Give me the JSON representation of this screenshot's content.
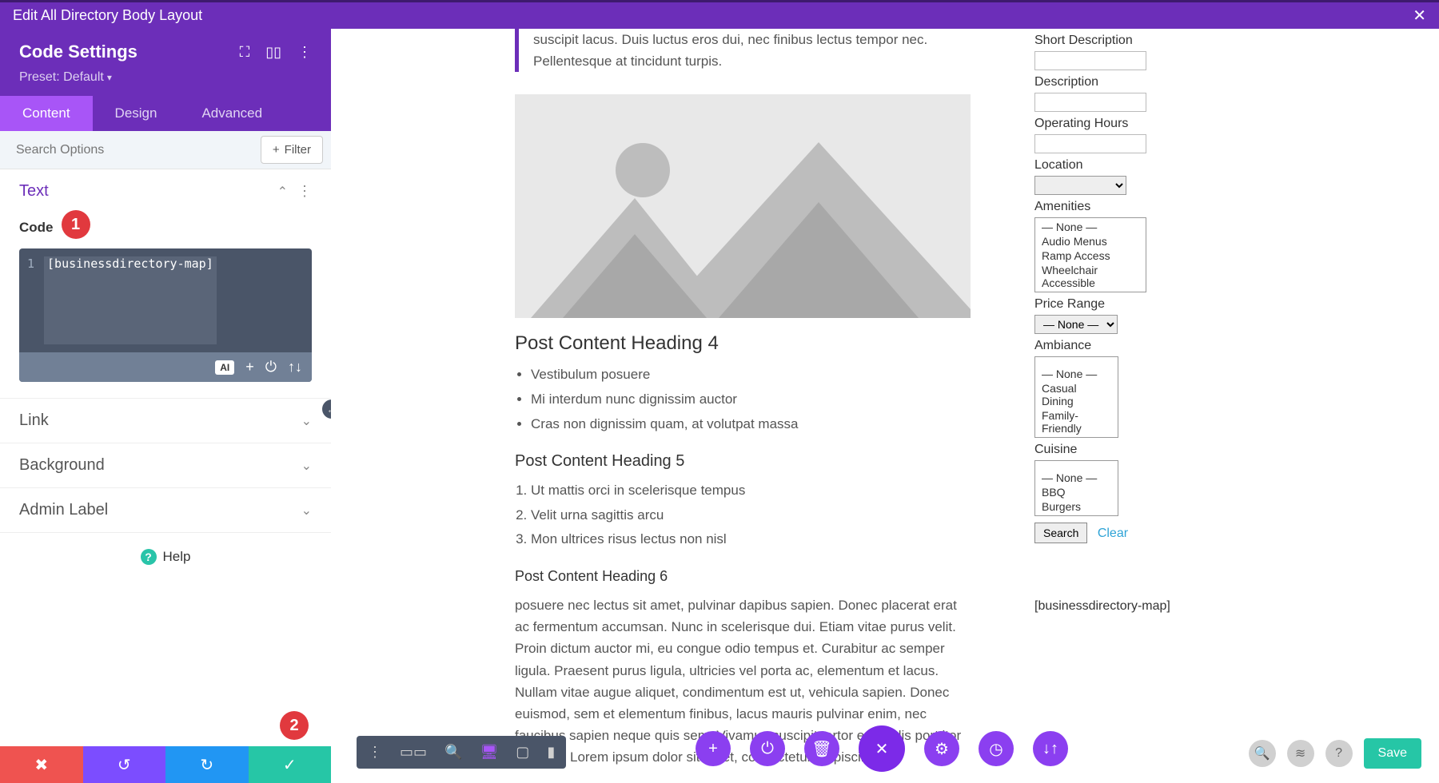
{
  "topbar": {
    "title": "Edit All Directory Body Layout"
  },
  "panel": {
    "title": "Code Settings",
    "preset": "Preset: Default",
    "tabs": {
      "content": "Content",
      "design": "Design",
      "advanced": "Advanced"
    },
    "search_placeholder": "Search Options",
    "filter": "Filter"
  },
  "sections": {
    "text": {
      "title": "Text",
      "code_label": "Code",
      "code_value": "[businessdirectory-map]"
    },
    "link": "Link",
    "background": "Background",
    "admin_label": "Admin Label"
  },
  "help": "Help",
  "markers": {
    "m1": "1",
    "m2": "2"
  },
  "post": {
    "quote": "suscipit lacus. Duis luctus eros dui, nec finibus lectus tempor nec. Pellentesque at tincidunt turpis.",
    "h4": "Post Content Heading 4",
    "ul": [
      "Vestibulum posuere",
      "Mi interdum nunc dignissim auctor",
      "Cras non dignissim quam, at volutpat massa"
    ],
    "h5": "Post Content Heading 5",
    "ol": [
      "Ut mattis orci in scelerisque tempus",
      "Velit urna sagittis arcu",
      "Mon ultrices risus lectus non nisl"
    ],
    "h6": "Post Content Heading 6",
    "p6": "posuere nec lectus sit amet, pulvinar dapibus sapien. Donec placerat erat ac fermentum accumsan. Nunc in scelerisque dui. Etiam vitae purus velit. Proin dictum auctor mi, eu congue odio tempus et. Curabitur ac semper ligula. Praesent purus ligula, ultricies vel porta ac, elementum et lacus. Nullam vitae augue aliquet, condimentum est ut, vehicula sapien. Donec euismod, sem et elementum finibus, lacus mauris pulvinar enim, nec faucibus sapien neque quis sem. Vivamus suscipit tortor eget felis porttitor volutpat. Lorem ipsum dolor sit amet, consectetur adipiscing elit."
  },
  "form": {
    "short_desc": "Short Description",
    "description": "Description",
    "hours": "Operating Hours",
    "location": "Location",
    "amenities": "Amenities",
    "amenities_opts": [
      "— None —",
      "Audio Menus",
      "Ramp Access",
      "Wheelchair Accessible"
    ],
    "price": "Price Range",
    "price_sel": "— None —",
    "ambiance": "Ambiance",
    "ambiance_opts": [
      "— None —",
      "Casual Dining",
      "Family-Friendly"
    ],
    "cuisine": "Cuisine",
    "cuisine_opts": [
      "— None —",
      "BBQ",
      "Burgers"
    ],
    "search": "Search",
    "clear": "Clear",
    "shortcode": "[businessdirectory-map]"
  },
  "save": "Save"
}
